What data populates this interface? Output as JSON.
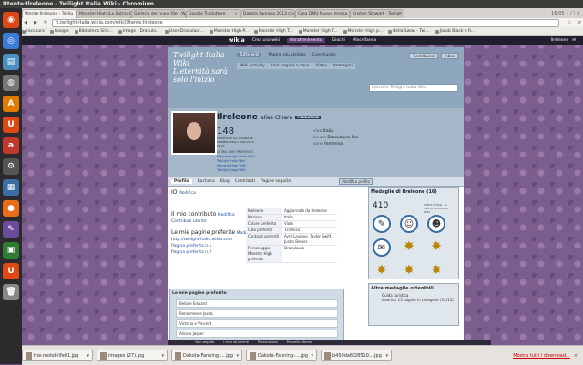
{
  "window": {
    "title": "Utente:Ilreleone - Twilight Italia Wiki - Chromium",
    "clock": "16:05"
  },
  "tabs": [
    {
      "label": "Utente:Ilreleone - Twilig"
    },
    {
      "label": "Monster High (Lo Extrave"
    },
    {
      "label": "Galleria dei nuovi file - W"
    },
    {
      "label": "Google Traduttore"
    },
    {
      "label": "Dakota Fanning 2013 styl"
    },
    {
      "label": "Crea DMU Nuovo messa"
    },
    {
      "label": "Kristen Stewart - Twiligh"
    }
  ],
  "address": {
    "url": "it.twilight-italia.wikia.com/wiki/Utente:Ilreleone"
  },
  "bookmarks": [
    "raccaura",
    "Google",
    "Biblioteca Silvi...",
    "Image - Dracula...",
    "User:Draculaur...",
    "Monster High-P...",
    "Monster High T...",
    "Monster High T...",
    "Monster High p...",
    "Bella Swan - Twi...",
    "Jacob Black e R..."
  ],
  "wikia": {
    "logo": "wikia",
    "start": "Crea una wiki",
    "nav": [
      "Intrattenimento",
      "Giochi",
      "Miscellanea"
    ],
    "user": "Ilreleone"
  },
  "wiki": {
    "sitename": "Twilight Italia Wiki L'eternità sarà solo l'inizio",
    "topnav": [
      "Tutte wiki",
      "Pagine più visitate",
      "Community"
    ],
    "subnav": [
      "Wiki Activity",
      "Una pagina a caso",
      "Video",
      "Immagini"
    ],
    "hdrbtns": [
      "Contribuisci",
      "Inbox"
    ],
    "search_placeholder": "Cerca in Twilight Italia Wiki"
  },
  "profile": {
    "username": "Ilreleone",
    "alias": "alias Chiara",
    "badge": "FONDATORE",
    "edits": "148",
    "edits_sub": "MODIFICHE DA QUANDO È MEMBRO DELLA WIKI 2013-06-27",
    "facts": [
      {
        "k": "vivo",
        "v": "Italia"
      },
      {
        "k": "lavoro",
        "v": "Draculaura Fan"
      },
      {
        "k": "sono",
        "v": "femmina"
      }
    ],
    "last_edit_label": "LE MIE WIKI PREFERITE",
    "wikis": [
      "Monster High Italia Wiki",
      "Twilight Italia Wiki",
      "Monster High Wiki",
      "Twilight Saga Wiki"
    ]
  },
  "profile_tabs": [
    "Profilo",
    "Bacheca",
    "Blog",
    "Contributi",
    "Pagine seguite"
  ],
  "customize": "Modifica profilo",
  "content": {
    "intro_head": "IO",
    "edit": "Modifica",
    "heading2": "Il mio contributo",
    "contrib_link": "Contributi utente",
    "heading3": "Le mie pagine preferite",
    "links": [
      "http://twilight-italia.wikia.com",
      "Pagina preferita n.1",
      "Pagina preferita n.2"
    ],
    "infobox": [
      {
        "k": "Ilreleone",
        "v": "Aggiornata da Ilreleone"
      },
      {
        "k": "Nazione",
        "v": "Italia"
      },
      {
        "k": "Colore preferito",
        "v": "Viola"
      },
      {
        "k": "Cibo preferito",
        "v": "Tiramisù"
      },
      {
        "k": "Cantanti preferiti",
        "v": "Avril Lavigne, Taylor Swift, Justin Bieber"
      },
      {
        "k": "Personaggio Monster High preferito",
        "v": "Draculaura"
      }
    ],
    "section_title": "Le mie pagine preferite",
    "section_items": [
      "Bella e Edward",
      "Renesmee e Jacob",
      "Victoria e Vincent",
      "Alice e Jasper"
    ]
  },
  "rail": {
    "medals_title": "Medaglie di Ilreleone (16)",
    "score": "410",
    "score_sub": "PUNTI TOTALI · IL POSTO IN QUESTA WIKI",
    "more_title": "Altre medaglie ottenibili",
    "more_item": "Guida turistica",
    "more_sub": "Inserisci 15 pagine in categorie (14/15)"
  },
  "footer": [
    "Voci seguite",
    "I miei strumenti",
    "Personalizza",
    "Pannello utente"
  ],
  "downloads": [
    "the-motel-life01.jpg",
    "images (27).jpg",
    "Dakota-Fanning-....jpg",
    "Dakota-Fanning-....jpg",
    "b450da6f28510....jpg"
  ],
  "download_showall": "Mostra tutti i download..."
}
